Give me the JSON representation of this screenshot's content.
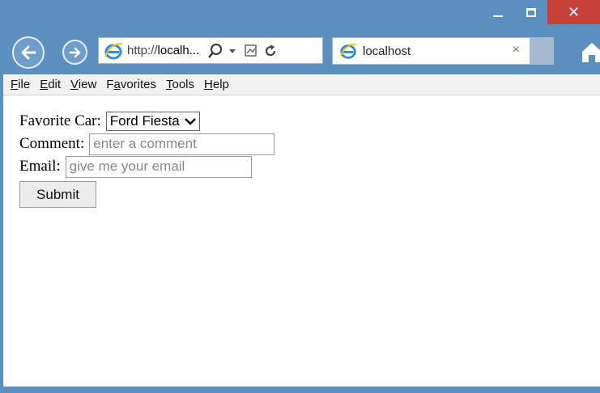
{
  "window": {
    "minimize_icon": "minimize-icon",
    "maximize_icon": "maximize-icon",
    "close_icon": "close-icon",
    "close_glyph": "✕",
    "close_color": "#c7403a",
    "frame_color": "#5a8fc0"
  },
  "nav": {
    "back_icon": "back-arrow-icon",
    "forward_icon": "forward-arrow-icon",
    "address_prefix": "http://",
    "address_host": "localh...",
    "search_icon": "search-icon",
    "dropdown_icon": "dropdown-arrow-icon",
    "compat_icon": "compatibility-view-icon",
    "refresh_icon": "refresh-icon",
    "home_icon": "home-icon"
  },
  "tab": {
    "title": "localhost",
    "close_glyph": "×"
  },
  "menu": {
    "items": [
      {
        "key": "F",
        "rest": "ile"
      },
      {
        "key": "E",
        "rest": "dit"
      },
      {
        "key": "V",
        "rest": "iew"
      },
      {
        "key": "a",
        "pre": "F",
        "rest": "vorites"
      },
      {
        "key": "T",
        "rest": "ools"
      },
      {
        "key": "H",
        "rest": "elp"
      }
    ]
  },
  "form": {
    "car_label": "Favorite Car:",
    "car_value": "Ford Fiesta",
    "comment_label": "Comment:",
    "comment_placeholder": "enter a comment",
    "email_label": "Email:",
    "email_placeholder": "give me your email",
    "submit_label": "Submit"
  }
}
